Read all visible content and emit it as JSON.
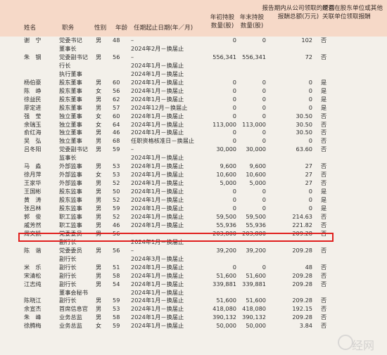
{
  "header": {
    "name": "姓名",
    "position": "职务",
    "gender": "性别",
    "age": "年龄",
    "term": "任期起止日期(年／月)",
    "start_shares": "年初持股数量(股)",
    "end_shares": "年末持股数量(股)",
    "pay": "报告期内从公司领取的税前报酬总额(万元)",
    "related": "是否在股东单位或其他关联单位领取报酬"
  },
  "rows": [
    {
      "name": "谢　宁",
      "position": "党委书记",
      "gender": "男",
      "age": "48",
      "term": "–",
      "start": "0",
      "end": "0",
      "pay": "102",
      "related": "否"
    },
    {
      "name": "",
      "position": "董事长",
      "gender": "",
      "age": "",
      "term": "2024年2月－换届止",
      "start": "",
      "end": "",
      "pay": "",
      "related": ""
    },
    {
      "name": "朱　钢",
      "position": "党委副书记",
      "gender": "男",
      "age": "56",
      "term": "–",
      "start": "556,341",
      "end": "556,341",
      "pay": "72",
      "related": "否"
    },
    {
      "name": "",
      "position": "行长",
      "gender": "",
      "age": "",
      "term": "2024年1月－换届止",
      "start": "",
      "end": "",
      "pay": "",
      "related": ""
    },
    {
      "name": "",
      "position": "执行董事",
      "gender": "",
      "age": "",
      "term": "2024年1月－换届止",
      "start": "",
      "end": "",
      "pay": "",
      "related": ""
    },
    {
      "name": "杨伯豪",
      "position": "股东董事",
      "gender": "男",
      "age": "60",
      "term": "2024年1月－换届止",
      "start": "0",
      "end": "0",
      "pay": "0",
      "related": "是"
    },
    {
      "name": "陈　峥",
      "position": "股东董事",
      "gender": "女",
      "age": "56",
      "term": "2024年1月－换届止",
      "start": "0",
      "end": "0",
      "pay": "0",
      "related": "是"
    },
    {
      "name": "徐益民",
      "position": "股东董事",
      "gender": "男",
      "age": "62",
      "term": "2024年1月－换届止",
      "start": "0",
      "end": "0",
      "pay": "0",
      "related": "是"
    },
    {
      "name": "廖定进",
      "position": "股东董事",
      "gender": "男",
      "age": "57",
      "term": "2024年12月－换届止",
      "start": "0",
      "end": "0",
      "pay": "0",
      "related": "是"
    },
    {
      "name": "强　莹",
      "position": "独立董事",
      "gender": "女",
      "age": "60",
      "term": "2024年1月－换届止",
      "start": "0",
      "end": "0",
      "pay": "30.50",
      "related": "否"
    },
    {
      "name": "余瑞玉",
      "position": "独立董事",
      "gender": "女",
      "age": "64",
      "term": "2024年1月－换届止",
      "start": "113,000",
      "end": "113,000",
      "pay": "30.50",
      "related": "否"
    },
    {
      "name": "俞红海",
      "position": "独立董事",
      "gender": "男",
      "age": "46",
      "term": "2024年1月－换届止",
      "start": "0",
      "end": "0",
      "pay": "30.50",
      "related": "否"
    },
    {
      "name": "吴　弘",
      "position": "独立董事",
      "gender": "男",
      "age": "68",
      "term": "任职资格核准日－换届止",
      "start": "0",
      "end": "0",
      "pay": "0",
      "related": "否"
    },
    {
      "name": "吕冬阳",
      "position": "党委副书记",
      "gender": "男",
      "age": "59",
      "term": "–",
      "start": "30,000",
      "end": "30,000",
      "pay": "63.60",
      "related": "否"
    },
    {
      "name": "",
      "position": "监事长",
      "gender": "",
      "age": "",
      "term": "2024年1月－换届止",
      "start": "",
      "end": "",
      "pay": "",
      "related": ""
    },
    {
      "name": "马　淼",
      "position": "外部监事",
      "gender": "男",
      "age": "53",
      "term": "2024年1月－换届止",
      "start": "9,600",
      "end": "9,600",
      "pay": "27",
      "related": "否"
    },
    {
      "name": "徐月萍",
      "position": "外部监事",
      "gender": "女",
      "age": "53",
      "term": "2024年1月－换届止",
      "start": "10,600",
      "end": "10,600",
      "pay": "27",
      "related": "否"
    },
    {
      "name": "王家华",
      "position": "外部监事",
      "gender": "男",
      "age": "52",
      "term": "2024年1月－换届止",
      "start": "5,000",
      "end": "5,000",
      "pay": "27",
      "related": "否"
    },
    {
      "name": "王国彬",
      "position": "股东监事",
      "gender": "男",
      "age": "50",
      "term": "2024年1月－换届止",
      "start": "0",
      "end": "0",
      "pay": "0",
      "related": "是"
    },
    {
      "name": "黄　涛",
      "position": "股东监事",
      "gender": "男",
      "age": "52",
      "term": "2024年1月－换届止",
      "start": "0",
      "end": "0",
      "pay": "0",
      "related": "是"
    },
    {
      "name": "张吕林",
      "position": "股东监事",
      "gender": "男",
      "age": "59",
      "term": "2024年1月－换届止",
      "start": "0",
      "end": "0",
      "pay": "0",
      "related": "是"
    },
    {
      "name": "郭　俊",
      "position": "职工监事",
      "gender": "男",
      "age": "52",
      "term": "2024年1月－换届止",
      "start": "59,500",
      "end": "59,500",
      "pay": "214.63",
      "related": "否"
    },
    {
      "name": "戚芳然",
      "position": "职工监事",
      "gender": "男",
      "age": "46",
      "term": "2024年1月－换届止",
      "start": "55,936",
      "end": "55,936",
      "pay": "221.82",
      "related": "否"
    },
    {
      "name": "周文凯",
      "position": "党委委员",
      "gender": "男",
      "age": "56",
      "term": "–",
      "start": "203,800",
      "end": "203,800",
      "pay": "209.28",
      "related": "否"
    },
    {
      "name": "",
      "position": "副行长",
      "gender": "",
      "age": "",
      "term": "2024年1月－换届止",
      "start": "",
      "end": "",
      "pay": "",
      "related": ""
    },
    {
      "name": "陈　谐",
      "position": "党委委员",
      "gender": "男",
      "age": "56",
      "term": "–",
      "start": "39,200",
      "end": "39,200",
      "pay": "209.28",
      "related": "否"
    },
    {
      "name": "",
      "position": "副行长",
      "gender": "",
      "age": "",
      "term": "2024年3月－换届止",
      "start": "",
      "end": "",
      "pay": "",
      "related": ""
    },
    {
      "name": "米　乐",
      "position": "副行长",
      "gender": "男",
      "age": "51",
      "term": "2024年1月－换届止",
      "start": "0",
      "end": "0",
      "pay": "48",
      "related": "否"
    },
    {
      "name": "宋清松",
      "position": "副行长",
      "gender": "男",
      "age": "58",
      "term": "2024年1月－换届止",
      "start": "51,600",
      "end": "51,600",
      "pay": "209.28",
      "related": "否"
    },
    {
      "name": "江志纯",
      "position": "副行长",
      "gender": "男",
      "age": "54",
      "term": "2024年1月－换届止",
      "start": "339,881",
      "end": "339,881",
      "pay": "209.28",
      "related": "否"
    },
    {
      "name": "",
      "position": "董事会秘书",
      "gender": "",
      "age": "",
      "term": "2024年1月－换届止",
      "start": "",
      "end": "",
      "pay": "",
      "related": ""
    },
    {
      "name": "陈晓江",
      "position": "副行长",
      "gender": "男",
      "age": "59",
      "term": "2024年1月－换届止",
      "start": "51,600",
      "end": "51,600",
      "pay": "209.28",
      "related": "否"
    },
    {
      "name": "余宣杰",
      "position": "首席信息官",
      "gender": "男",
      "age": "53",
      "term": "2024年1月－换届止",
      "start": "418,080",
      "end": "418,080",
      "pay": "192.15",
      "related": "否"
    },
    {
      "name": "朱　峰",
      "position": "业务总监",
      "gender": "男",
      "age": "58",
      "term": "2024年1月－换届止",
      "start": "390,132",
      "end": "390,132",
      "pay": "209.28",
      "related": "否"
    },
    {
      "name": "徐腾梅",
      "position": "业务总监",
      "gender": "女",
      "age": "59",
      "term": "2024年1月－换届止",
      "start": "50,000",
      "end": "50,000",
      "pay": "3.84",
      "related": "否"
    }
  ],
  "highlight_row_index": 22,
  "colors": {
    "header_bg": "#f6d9c8",
    "page_bg": "#f3f0ea",
    "highlight": "#e0201e"
  }
}
